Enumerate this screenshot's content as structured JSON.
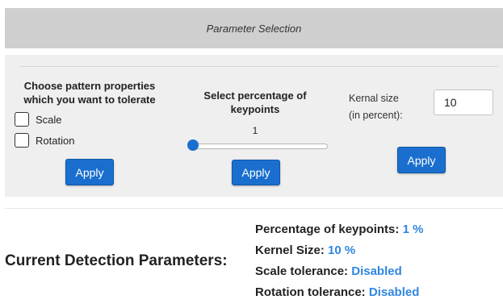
{
  "header": {
    "title": "Parameter Selection"
  },
  "pattern": {
    "heading_line1": "Choose pattern properties",
    "heading_line2": "which you want to tolerate",
    "options": [
      {
        "label": "Scale",
        "checked": false
      },
      {
        "label": "Rotation",
        "checked": false
      }
    ],
    "apply_label": "Apply"
  },
  "keypoints": {
    "heading_line1": "Select percentage of",
    "heading_line2": "keypoints",
    "value": "1",
    "slider_value": 1,
    "apply_label": "Apply"
  },
  "kernel": {
    "label_line1": "Kernal size",
    "label_line2": "(in percent):",
    "value": "10",
    "apply_label": "Apply"
  },
  "current": {
    "title": "Current Detection Parameters:",
    "rows": [
      {
        "label": "Percentage of keypoints:",
        "value": "1 %"
      },
      {
        "label": "Kernel Size:",
        "value": "10 %"
      },
      {
        "label": "Scale tolerance:",
        "value": "Disabled"
      },
      {
        "label": "Rotation tolerance:",
        "value": "Disabled"
      }
    ]
  },
  "colors": {
    "accent": "#1a6fce",
    "value_text": "#2f86e0",
    "header_bg": "#cfcfcf",
    "panel_bg": "#efefef"
  }
}
